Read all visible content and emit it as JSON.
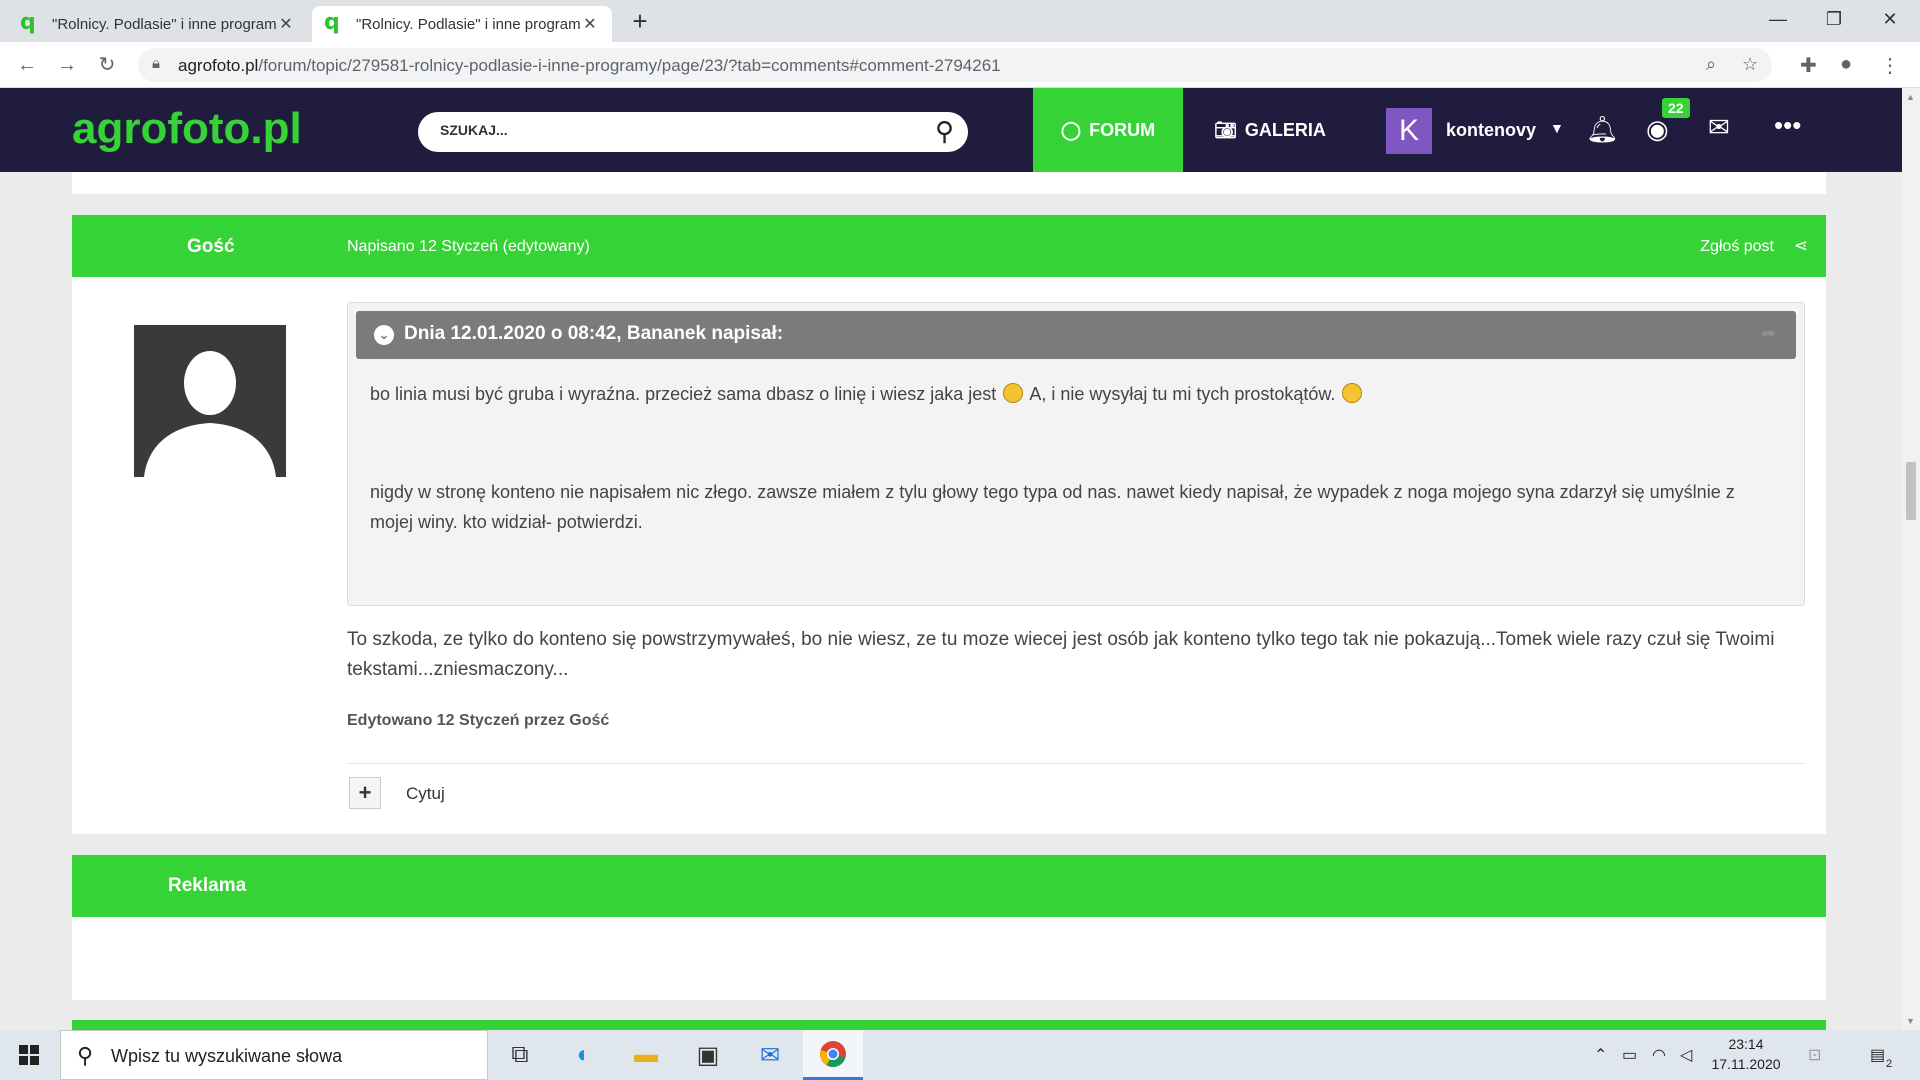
{
  "browser": {
    "tabs": [
      {
        "title": "\"Rolnicy. Podlasie\" i inne programy",
        "active": false
      },
      {
        "title": "\"Rolnicy. Podlasie\" i inne programy",
        "active": true
      }
    ],
    "url_host": "agrofoto.pl",
    "url_path": "/forum/topic/279581-rolnicy-podlasie-i-inne-programy/page/23/?tab=comments#comment-2794261"
  },
  "site": {
    "logo": "agrofoto.pl",
    "search_placeholder": "SZUKAJ...",
    "nav_forum": "FORUM",
    "nav_galeria": "GALERIA",
    "user_initial": "K",
    "username": "kontenovy",
    "views_badge": "22"
  },
  "post": {
    "author": "Gość",
    "date": "Napisano 12 Styczeń (edytowany)",
    "report": "Zgłoś post",
    "quote_cite": "Dnia 12.01.2020 o 08:42, Bananek napisał:",
    "quote_p1_a": "bo linia musi być gruba i wyraźna. przecież sama dbasz o linię i wiesz jaka jest",
    "quote_p1_b": "A, i nie wysyłaj tu mi tych prostokątów.",
    "quote_p2": "nigdy w stronę konteno nie napisałem nic złego. zawsze miałem z tylu głowy tego typa od nas. nawet kiedy napisał, że wypadek z noga mojego syna zdarzył się umyślnie z mojej winy. kto widział- potwierdzi.",
    "body": "To szkoda, ze tylko do konteno się powstrzymywałeś, bo nie wiesz, ze tu moze wiecej jest osób jak konteno tylko tego tak nie pokazują...Tomek wiele razy czuł się Twoimi tekstami...zniesmaczony...",
    "edited": "Edytowano 12 Styczeń przez Gość",
    "quote_button": "Cytuj"
  },
  "ad": {
    "title": "Reklama"
  },
  "taskbar": {
    "search_placeholder": "Wpisz tu wyszukiwane słowa",
    "time": "23:14",
    "date": "17.11.2020",
    "notification_count": "2"
  },
  "colors": {
    "accent": "#36d336",
    "header": "#1f1c3d",
    "quote_head": "#7b7b7b"
  }
}
